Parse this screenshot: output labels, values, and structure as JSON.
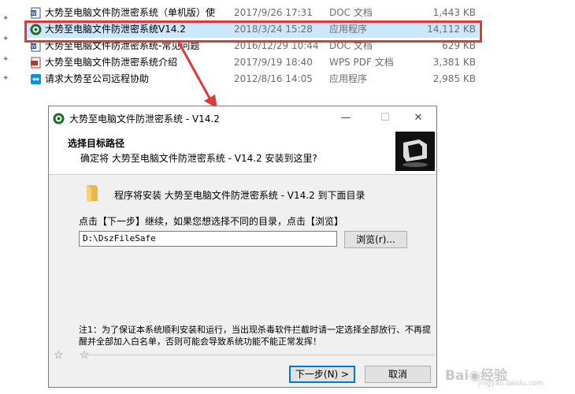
{
  "files": [
    {
      "name": "大势至电脑文件防泄密系统（单机版）使",
      "date": "2017/9/26 17:31",
      "type": "DOC 文档",
      "size": "1,443 KB",
      "icon": "word-doc-icon"
    },
    {
      "name": "大势至电脑文件防泄密系统V14.2",
      "date": "2018/3/24 15:28",
      "type": "应用程序",
      "size": "14,112 KB",
      "icon": "app-exe-icon",
      "selected": true
    },
    {
      "name": "大势至电脑文件防泄密系统-常见问题",
      "date": "2016/12/29 10:44",
      "type": "DOC 文档",
      "size": "629 KB",
      "icon": "word-doc-icon"
    },
    {
      "name": "大势至电脑文件防泄密系统介绍",
      "date": "2017/9/19 18:40",
      "type": "WPS PDF 文档",
      "size": "3,381 KB",
      "icon": "pdf-icon"
    },
    {
      "name": "请求大势至公司远程协助",
      "date": "2012/8/16 14:05",
      "type": "应用程序",
      "size": "2,985 KB",
      "icon": "teamviewer-icon"
    }
  ],
  "dialog": {
    "title": "大势至电脑文件防泄密系统 - V14.2",
    "header_title": "选择目标路径",
    "header_subtitle": "确定将 大势至电脑文件防泄密系统 - V14.2 安装到这里?",
    "install_line": "程序将安装 大势至电脑文件防泄密系统 - V14.2 到下面目录",
    "instruction": "点击【下一步】继续，如果您想选择不同的目录，点击【浏览】",
    "path_value": "D:\\DszFileSafe",
    "browse_label": "浏览(r)...",
    "note": "注1：为了保证本系统顺利安装和运行，当出现杀毒软件拦截时请一定选择全部放行、不再提醒并全部加入白名单，否则可能会导致系统功能不能正常发挥！",
    "next_label": "下一步(N) >",
    "cancel_label": "取消",
    "stars": "☆ ☆"
  },
  "window_controls": {
    "minimize": "—",
    "maximize": "☐",
    "close": "✕"
  },
  "watermark": {
    "main": "Bai◉经验",
    "sub": "jingyan.baidu.com"
  },
  "colors": {
    "highlight_box": "#e0393a",
    "selection": "#cce8ff",
    "default_button_border": "#0078d7"
  }
}
